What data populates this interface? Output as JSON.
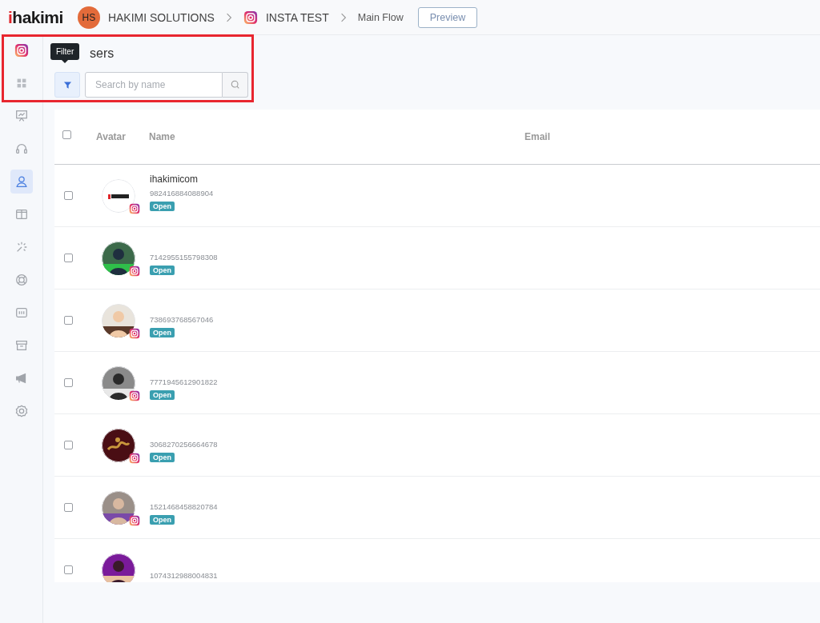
{
  "topbar": {
    "logo": {
      "accent": "i",
      "rest": "hakimi"
    },
    "workspace": {
      "initials": "HS",
      "name": "HAKIMI SOLUTIONS"
    },
    "channel": "INSTA TEST",
    "flow": "Main Flow",
    "preview_button": "Preview"
  },
  "sidebar": {
    "items": [
      {
        "kind": "instagram",
        "selected": false
      },
      {
        "kind": "grid",
        "selected": false
      },
      {
        "kind": "board",
        "selected": false
      },
      {
        "kind": "headset",
        "selected": false
      },
      {
        "kind": "user",
        "selected": true
      },
      {
        "kind": "columns",
        "selected": false
      },
      {
        "kind": "sparkle",
        "selected": false
      },
      {
        "kind": "lifebuoy",
        "selected": false
      },
      {
        "kind": "panel",
        "selected": false
      },
      {
        "kind": "archive",
        "selected": false
      },
      {
        "kind": "megaphone",
        "selected": false
      },
      {
        "kind": "gear",
        "selected": false
      }
    ]
  },
  "page": {
    "title": "sers",
    "tooltip": "Filter",
    "search": {
      "placeholder": "Search by name"
    }
  },
  "table": {
    "columns": [
      "Avatar",
      "Name",
      "Email"
    ],
    "all_checked": false,
    "rows": [
      {
        "name": "ihakimicom",
        "id": "982416884088904",
        "status": "Open",
        "checked": false
      },
      {
        "id": "7142955155798308",
        "status": "Open",
        "checked": false
      },
      {
        "id": "738693768567046",
        "status": "Open",
        "checked": false
      },
      {
        "id": "7771945612901822",
        "status": "Open",
        "checked": false
      },
      {
        "id": "3068270256664678",
        "status": "Open",
        "checked": false
      },
      {
        "id": "1521468458820784",
        "status": "Open",
        "checked": false
      },
      {
        "id": "1074312988004831",
        "checked": false
      }
    ]
  }
}
